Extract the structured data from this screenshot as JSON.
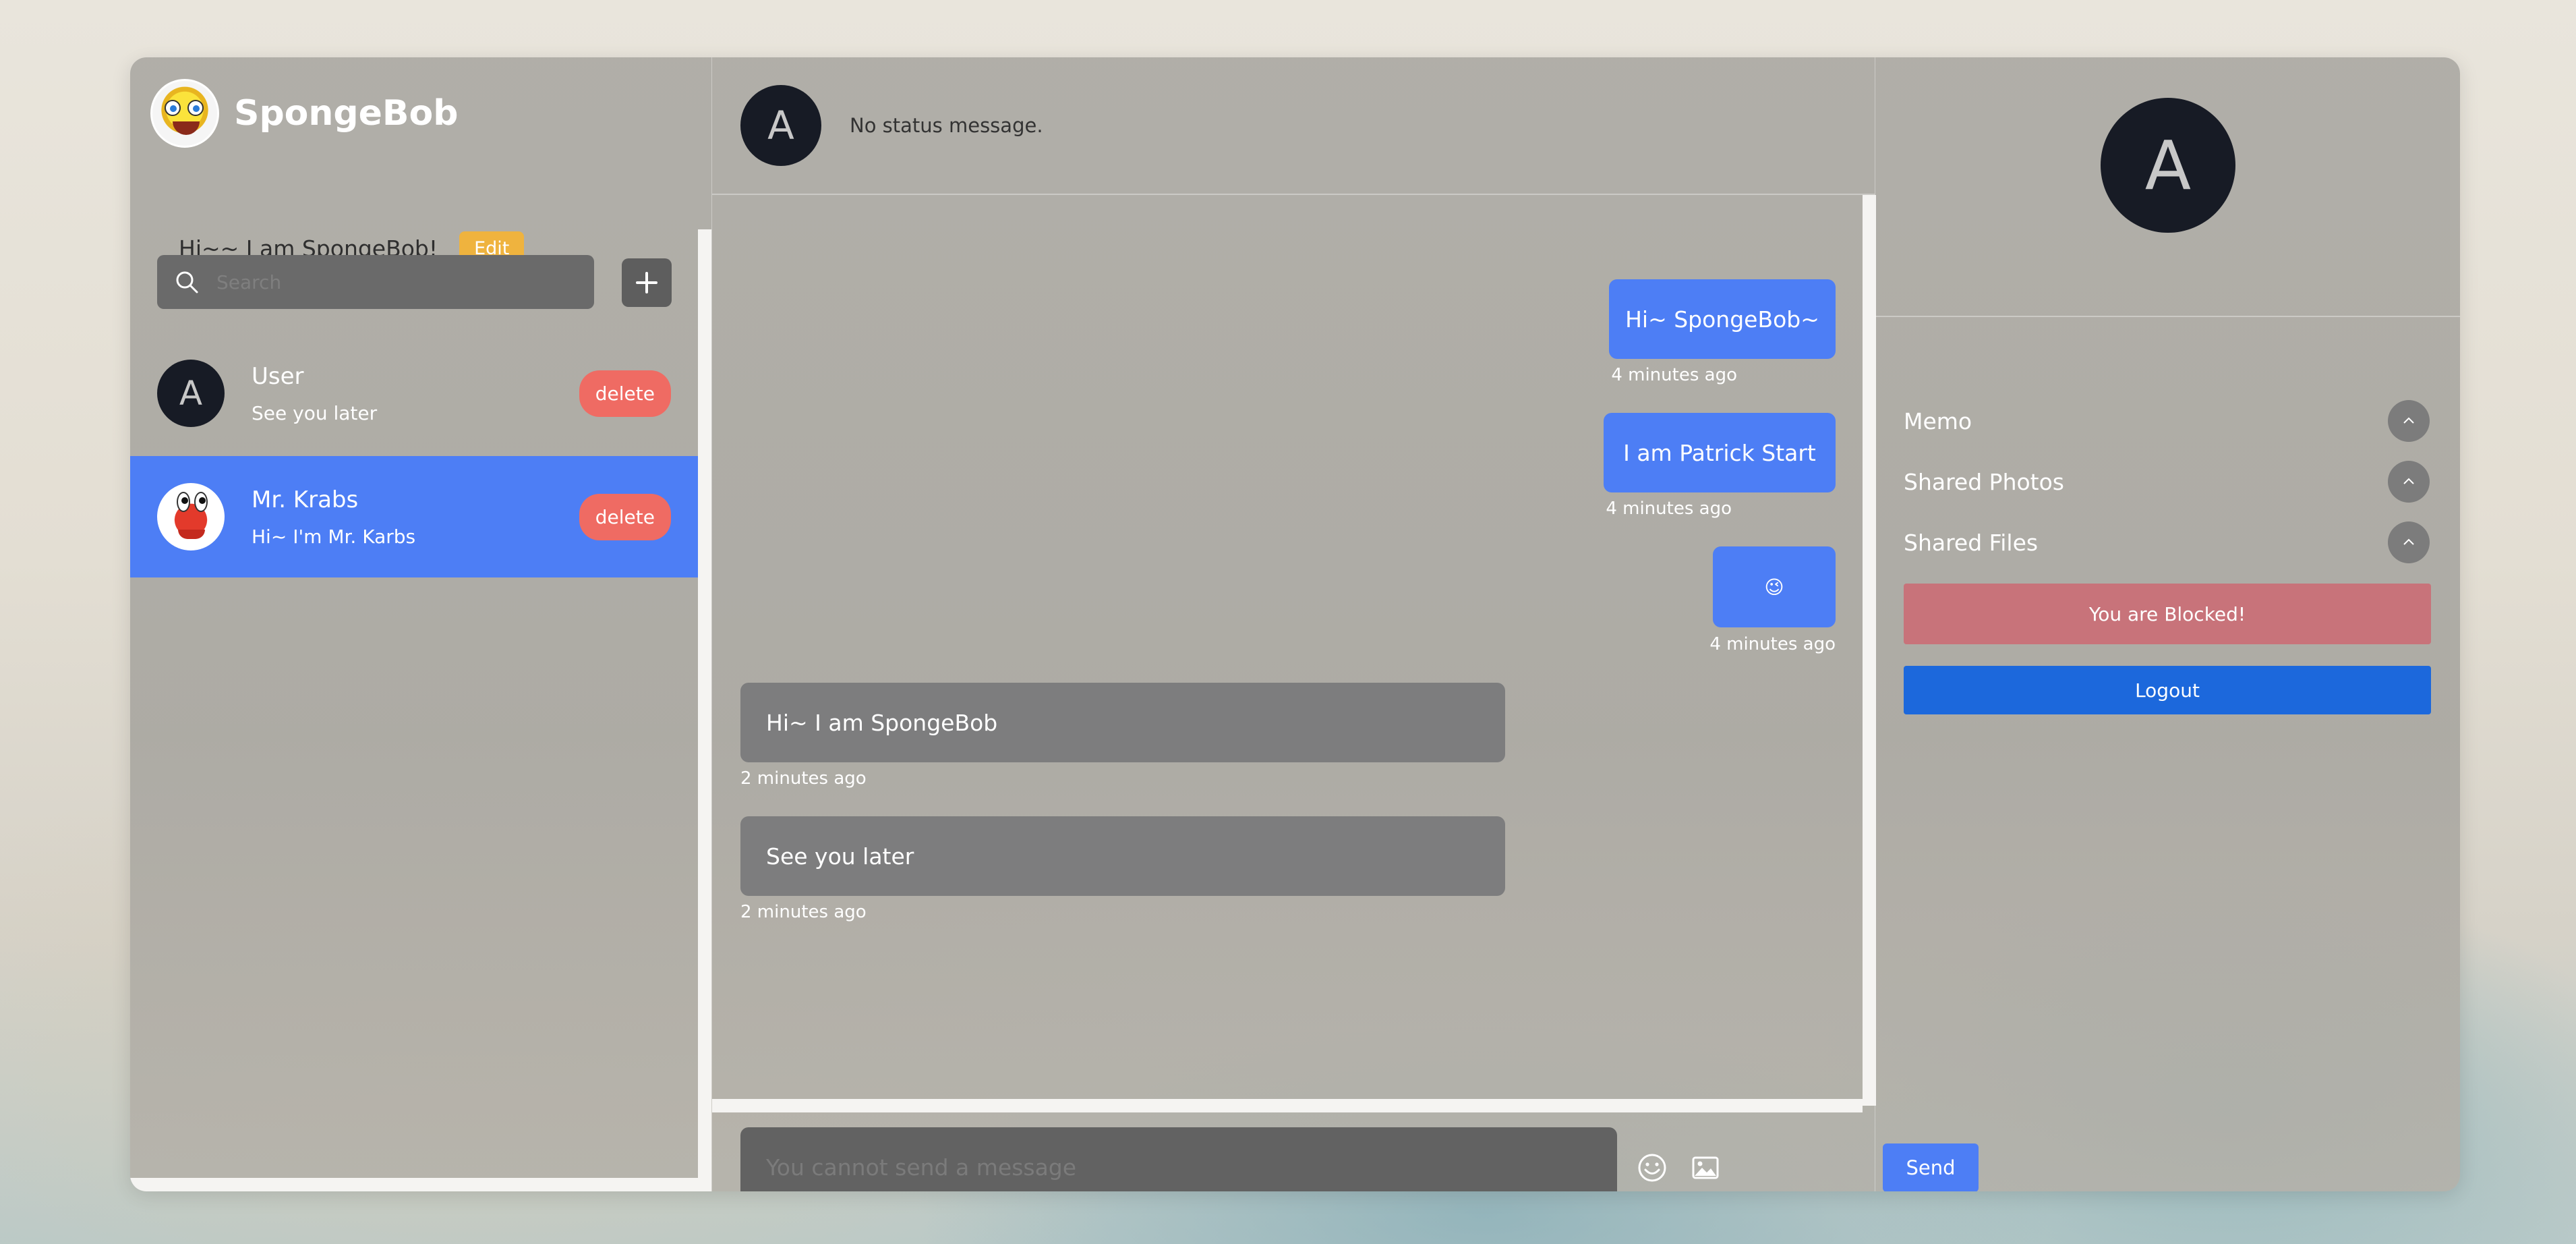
{
  "sidebar": {
    "app_name": "SpongeBob",
    "status_message": "Hi~~ I am SpongeBob!",
    "edit_label": "Edit",
    "search_placeholder": "Search",
    "contacts": [
      {
        "avatar_letter": "A",
        "name": "User",
        "last_message": "See you later",
        "delete_label": "delete"
      },
      {
        "name": "Mr. Krabs",
        "last_message": "Hi~ I'm Mr. Karbs",
        "delete_label": "delete"
      }
    ]
  },
  "chat": {
    "header_avatar_letter": "A",
    "header_status": "No status message.",
    "messages": [
      {
        "direction": "out",
        "text": "Hi~ SpongeBob~",
        "time": "4 minutes ago"
      },
      {
        "direction": "out",
        "text": "I am Patrick Start",
        "time": "4 minutes ago"
      },
      {
        "direction": "out",
        "text": "😉",
        "time": "4 minutes ago"
      },
      {
        "direction": "in",
        "text": "Hi~ I am SpongeBob",
        "time": "2 minutes ago"
      },
      {
        "direction": "in",
        "text": "See you later",
        "time": "2 minutes ago"
      }
    ],
    "input_placeholder": "You cannot send a message",
    "send_label": "Send"
  },
  "info": {
    "avatar_letter": "A",
    "sections": [
      "Memo",
      "Shared Photos",
      "Shared Files"
    ],
    "blocked_label": "You are Blocked!",
    "logout_label": "Logout"
  },
  "icons": {
    "search": "search-icon",
    "add": "plus-icon",
    "emoji": "smiley-icon",
    "image": "image-icon",
    "accordion": "chevron-up-icon"
  },
  "colors": {
    "accent_blue": "#4d7ef5",
    "delete_red": "#ef6b63",
    "edit_orange": "#efb33e",
    "blocked_pink": "#c8737a",
    "logout_blue": "#1c68dc",
    "avatar_dark": "#171b25"
  }
}
